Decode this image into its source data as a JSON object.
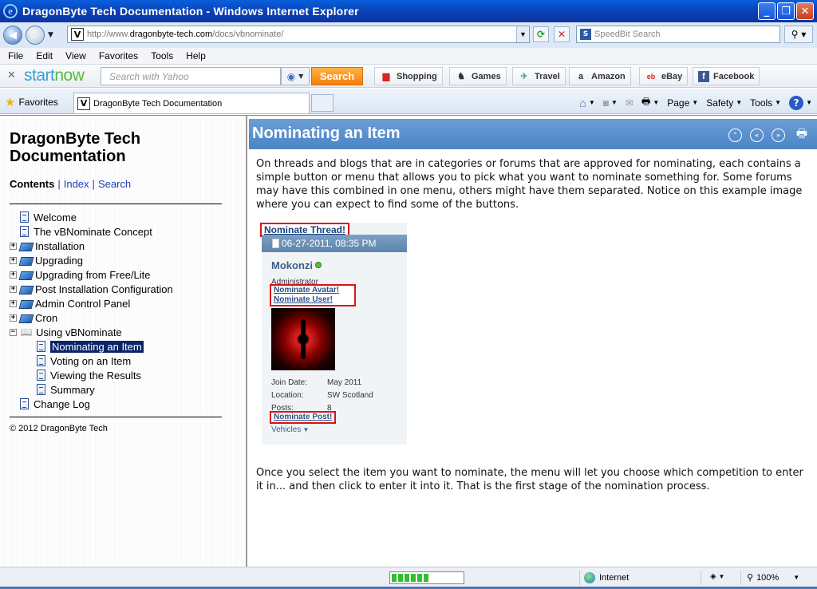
{
  "window": {
    "title": "DragonByte Tech Documentation - Windows Internet Explorer",
    "logo_letter": "e"
  },
  "address": {
    "url_prefix": "http://www.",
    "url_domain": "dragonbyte-tech.com",
    "url_path": "/docs/vbnominate/",
    "search_placeholder": "SpeedBit Search"
  },
  "menu": [
    "File",
    "Edit",
    "View",
    "Favorites",
    "Tools",
    "Help"
  ],
  "startnow": {
    "brand_start": "start",
    "brand_now": "now",
    "search_placeholder": "Search with Yahoo",
    "search_button": "Search",
    "links": [
      "Shopping",
      "Games",
      "Travel",
      "Amazon",
      "eBay",
      "Facebook"
    ]
  },
  "tabs": {
    "favorites_label": "Favorites",
    "active_tab": "DragonByte Tech Documentation"
  },
  "commandbar": {
    "page": "Page",
    "safety": "Safety",
    "tools": "Tools"
  },
  "sidebar": {
    "title": "DragonByte Tech Documentation",
    "links": {
      "contents": "Contents",
      "index": "Index",
      "search": "Search"
    },
    "tree": [
      {
        "label": "Welcome",
        "type": "page",
        "level": 0
      },
      {
        "label": "The vBNominate Concept",
        "type": "page",
        "level": 0
      },
      {
        "label": "Installation",
        "type": "book",
        "level": 0,
        "expand": "+"
      },
      {
        "label": "Upgrading",
        "type": "book",
        "level": 0,
        "expand": "+"
      },
      {
        "label": "Upgrading from Free/Lite",
        "type": "book",
        "level": 0,
        "expand": "+"
      },
      {
        "label": "Post Installation Configuration",
        "type": "book",
        "level": 0,
        "expand": "+"
      },
      {
        "label": "Admin Control Panel",
        "type": "book",
        "level": 0,
        "expand": "+"
      },
      {
        "label": "Cron",
        "type": "book",
        "level": 0,
        "expand": "+"
      },
      {
        "label": "Using vBNominate",
        "type": "openbook",
        "level": 0,
        "expand": "−"
      },
      {
        "label": "Nominating an Item",
        "type": "page",
        "level": 1,
        "selected": true
      },
      {
        "label": "Voting on an Item",
        "type": "page",
        "level": 1
      },
      {
        "label": "Viewing the Results",
        "type": "page",
        "level": 1
      },
      {
        "label": "Summary",
        "type": "page",
        "level": 1
      },
      {
        "label": "Change Log",
        "type": "page",
        "level": 0
      }
    ],
    "copyright": "© 2012 DragonByte Tech"
  },
  "main": {
    "title": "Nominating an Item",
    "para1": "On threads and blogs that are in categories or forums that are approved for nominating, each contains a simple button or menu that allows you to pick what you want to nominate something for. Some forums may have this combined in one menu, others might have them separated. Notice on this example image where you can expect to find some of the buttons.",
    "para2": "Once you select the item you want to nominate, the menu will let you choose which competition to enter it in... and then click to enter it into it. That is the first stage of the nomination process.",
    "example": {
      "nominate_thread": "Nominate Thread!",
      "date": "06-27-2011, 08:35 PM",
      "username": "Mokonzi",
      "role": "Administrator",
      "nominate_avatar": "Nominate Avatar!",
      "nominate_user": "Nominate User!",
      "stats": [
        {
          "key": "Join Date:",
          "value": "May 2011"
        },
        {
          "key": "Location:",
          "value": "SW Scotland"
        },
        {
          "key": "Posts:",
          "value": "8"
        }
      ],
      "nominate_post": "Nominate Post!",
      "vehicles": "Vehicles"
    }
  },
  "status": {
    "zone": "Internet",
    "zoom": "100%",
    "progress": 0.55
  },
  "colors": {
    "header_blue": "#5a8fcc",
    "highlight_red": "#dd1111",
    "selected_item": "#0a246a",
    "link_blue": "#1c3fb8"
  }
}
